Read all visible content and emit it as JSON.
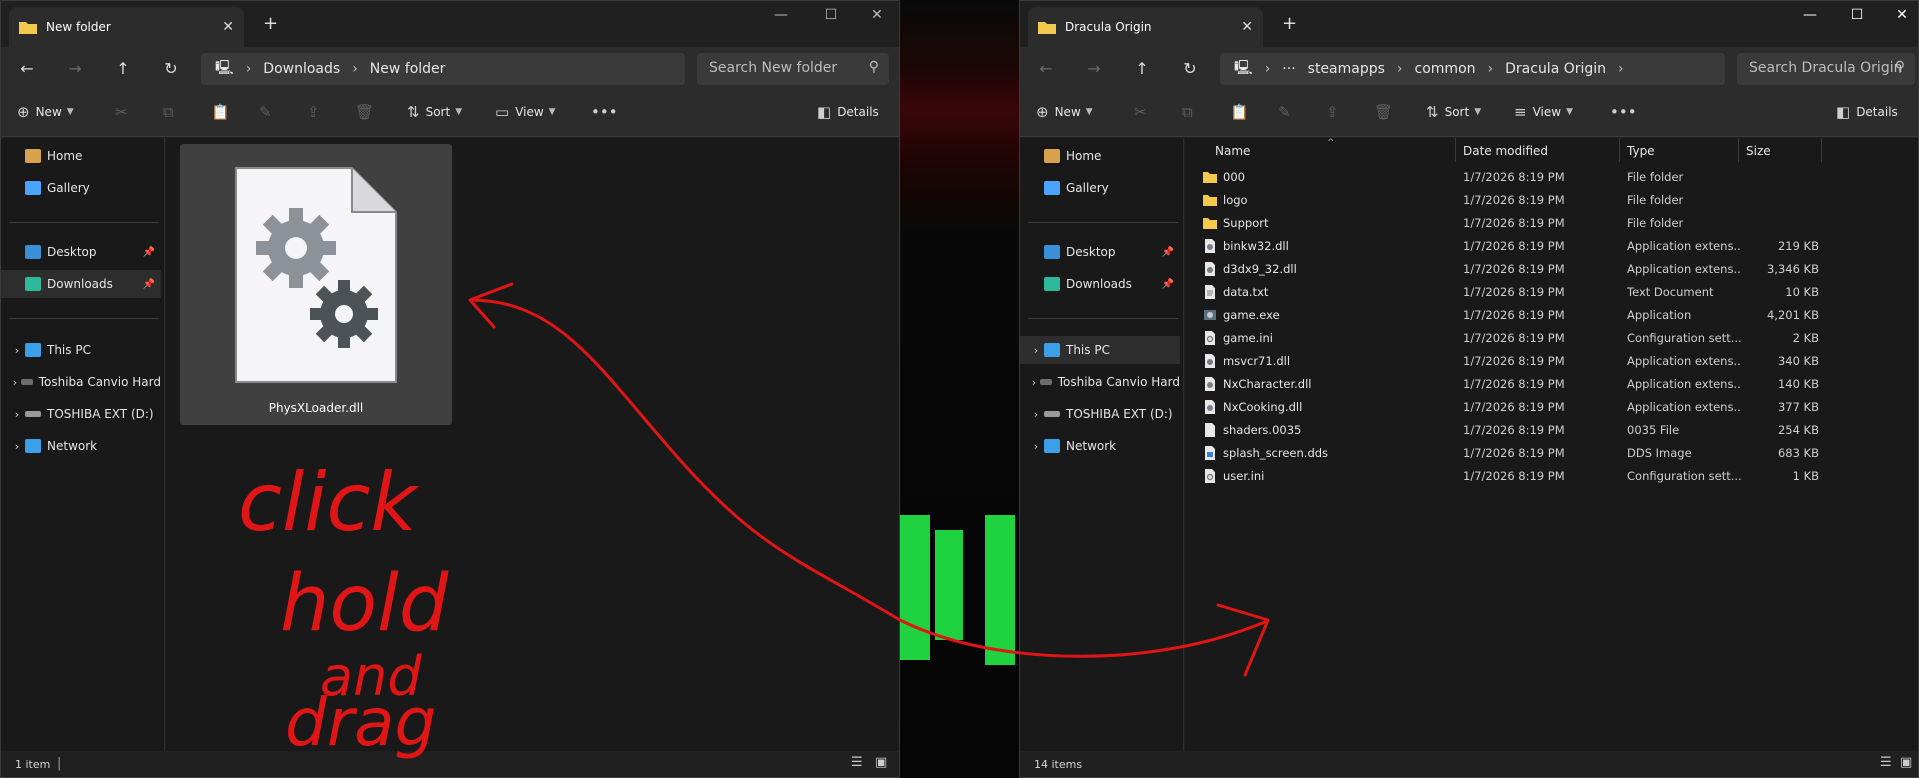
{
  "left_window": {
    "tab_title": "New folder",
    "address": {
      "crumbs": [
        "Downloads",
        "New folder"
      ],
      "search_placeholder": "Search New folder"
    },
    "toolbar": {
      "new": "New",
      "sort": "Sort",
      "view": "View",
      "details": "Details"
    },
    "sidebar": {
      "quick": [
        {
          "label": "Home",
          "icon": "home-icon"
        },
        {
          "label": "Gallery",
          "icon": "gallery-icon"
        }
      ],
      "pinned": [
        {
          "label": "Desktop",
          "icon": "desktop-icon"
        },
        {
          "label": "Downloads",
          "icon": "downloads-icon"
        }
      ],
      "drives": [
        {
          "label": "This PC",
          "icon": "pc-icon"
        },
        {
          "label": "Toshiba Canvio Hard",
          "icon": "drive-icon"
        },
        {
          "label": "TOSHIBA EXT (D:)",
          "icon": "drive-icon"
        },
        {
          "label": "Network",
          "icon": "network-icon"
        }
      ]
    },
    "file": {
      "name": "PhysXLoader.dll",
      "icon": "settings-file-icon"
    },
    "status": "1 item"
  },
  "right_window": {
    "tab_title": "Dracula Origin",
    "address": {
      "crumbs": [
        "steamapps",
        "common",
        "Dracula Origin"
      ],
      "search_placeholder": "Search Dracula Origin"
    },
    "toolbar": {
      "new": "New",
      "sort": "Sort",
      "view": "View",
      "details": "Details"
    },
    "sidebar": {
      "quick": [
        {
          "label": "Home",
          "icon": "home-icon"
        },
        {
          "label": "Gallery",
          "icon": "gallery-icon"
        }
      ],
      "pinned": [
        {
          "label": "Desktop",
          "icon": "desktop-icon"
        },
        {
          "label": "Downloads",
          "icon": "downloads-icon"
        }
      ],
      "drives": [
        {
          "label": "This PC",
          "icon": "pc-icon"
        },
        {
          "label": "Toshiba Canvio Hard",
          "icon": "drive-icon"
        },
        {
          "label": "TOSHIBA EXT (D:)",
          "icon": "drive-icon"
        },
        {
          "label": "Network",
          "icon": "network-icon"
        }
      ]
    },
    "columns": {
      "name": "Name",
      "date": "Date modified",
      "type": "Type",
      "size": "Size"
    },
    "files": [
      {
        "name": "000",
        "date": "1/7/2026 8:19 PM",
        "type": "File folder",
        "size": "",
        "icon": "folder"
      },
      {
        "name": "logo",
        "date": "1/7/2026 8:19 PM",
        "type": "File folder",
        "size": "",
        "icon": "folder"
      },
      {
        "name": "Support",
        "date": "1/7/2026 8:19 PM",
        "type": "File folder",
        "size": "",
        "icon": "folder"
      },
      {
        "name": "binkw32.dll",
        "date": "1/7/2026 8:19 PM",
        "type": "Application extens...",
        "size": "219 KB",
        "icon": "dll"
      },
      {
        "name": "d3dx9_32.dll",
        "date": "1/7/2026 8:19 PM",
        "type": "Application extens...",
        "size": "3,346 KB",
        "icon": "dll"
      },
      {
        "name": "data.txt",
        "date": "1/7/2026 8:19 PM",
        "type": "Text Document",
        "size": "10 KB",
        "icon": "txt"
      },
      {
        "name": "game.exe",
        "date": "1/7/2026 8:19 PM",
        "type": "Application",
        "size": "4,201 KB",
        "icon": "exe"
      },
      {
        "name": "game.ini",
        "date": "1/7/2026 8:19 PM",
        "type": "Configuration sett...",
        "size": "2 KB",
        "icon": "ini"
      },
      {
        "name": "msvcr71.dll",
        "date": "1/7/2026 8:19 PM",
        "type": "Application extens...",
        "size": "340 KB",
        "icon": "dll"
      },
      {
        "name": "NxCharacter.dll",
        "date": "1/7/2026 8:19 PM",
        "type": "Application extens...",
        "size": "140 KB",
        "icon": "dll"
      },
      {
        "name": "NxCooking.dll",
        "date": "1/7/2026 8:19 PM",
        "type": "Application extens...",
        "size": "377 KB",
        "icon": "dll"
      },
      {
        "name": "shaders.0035",
        "date": "1/7/2026 8:19 PM",
        "type": "0035 File",
        "size": "254 KB",
        "icon": "file"
      },
      {
        "name": "splash_screen.dds",
        "date": "1/7/2026 8:19 PM",
        "type": "DDS Image",
        "size": "683 KB",
        "icon": "image"
      },
      {
        "name": "user.ini",
        "date": "1/7/2026 8:19 PM",
        "type": "Configuration sett...",
        "size": "1 KB",
        "icon": "ini"
      }
    ],
    "status": "14 items"
  },
  "annotation": {
    "color": "#e01515",
    "lines": [
      "click",
      "hold",
      "and",
      "drag"
    ]
  },
  "colors": {
    "folder": "#f2c94c",
    "accent": "#4aa3ff"
  }
}
